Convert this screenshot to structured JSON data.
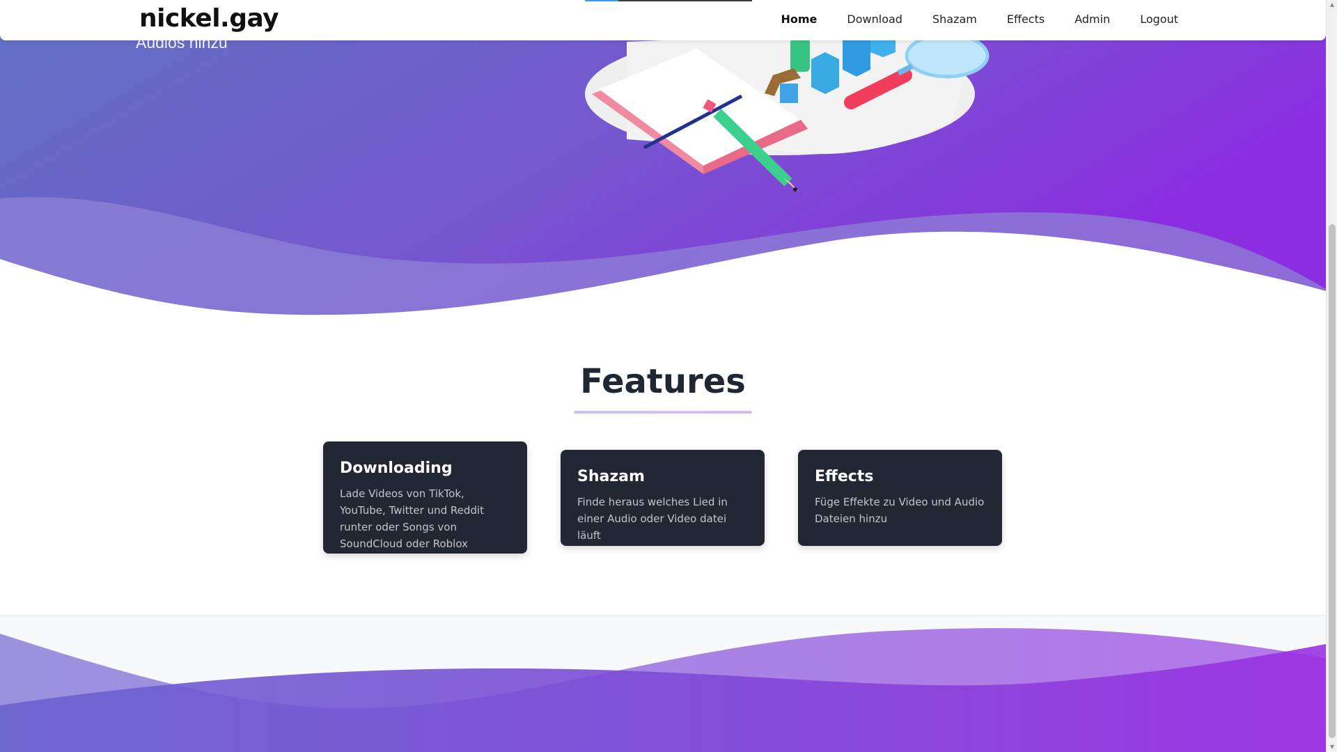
{
  "brand": "nickel.gay",
  "hero": {
    "subtitle": "Audios hinzu"
  },
  "nav": {
    "progress_fraction": 0.2,
    "links": [
      {
        "label": "Home",
        "active": true
      },
      {
        "label": "Download",
        "active": false
      },
      {
        "label": "Shazam",
        "active": false
      },
      {
        "label": "Effects",
        "active": false
      },
      {
        "label": "Admin",
        "active": false
      },
      {
        "label": "Logout",
        "active": false
      }
    ]
  },
  "features": {
    "title": "Features",
    "cards": [
      {
        "title": "Downloading",
        "text": "Lade Videos von TikTok, YouTube, Twitter und Reddit runter oder Songs von SoundCloud oder Roblox"
      },
      {
        "title": "Shazam",
        "text": "Finde heraus welches Lied in einer Audio oder Video datei läuft"
      },
      {
        "title": "Effects",
        "text": "Füge Effekte zu Video und Audio Dateien hinzu"
      }
    ]
  },
  "colors": {
    "gradient_start": "#5f74c4",
    "gradient_mid": "#7652cf",
    "gradient_end": "#8b2be0",
    "card_bg": "#212833",
    "nav_progress": "#3b9be8"
  },
  "icons": {
    "scroll_up": "▲",
    "scroll_down": "▼"
  }
}
